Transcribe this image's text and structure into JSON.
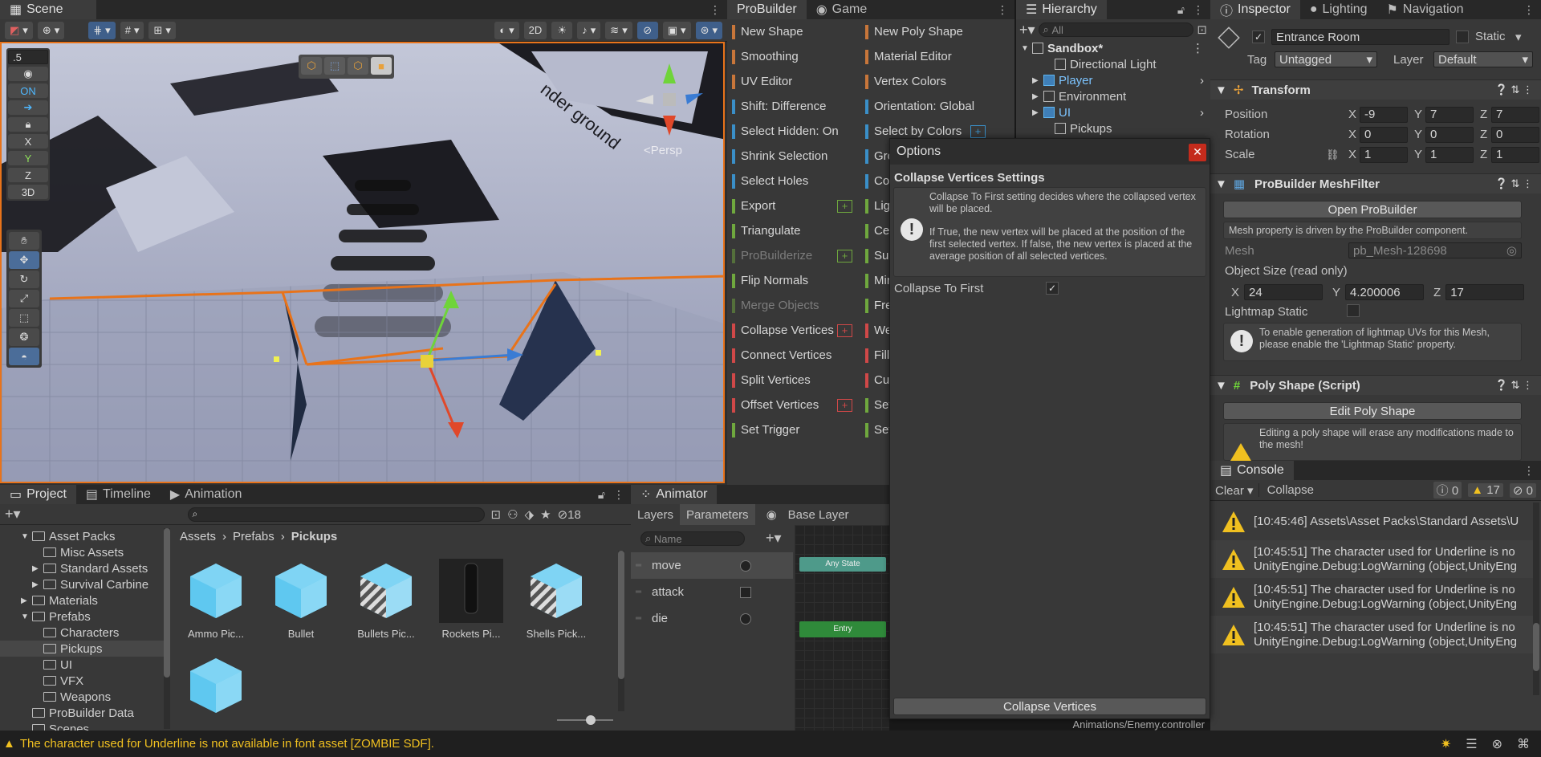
{
  "scene": {
    "tab": "Scene",
    "twod": "2D",
    "grid_snap": ".5",
    "on_label": "ON",
    "axes": [
      "X",
      "Y",
      "Z"
    ],
    "threed": "3D",
    "persp": "<Persp",
    "ground_text": "nder ground"
  },
  "probuilder": {
    "tab": "ProBuilder",
    "game_tab": "Game",
    "left": [
      {
        "label": "New Shape",
        "color": "#c8763a",
        "plus": false,
        "disabled": false
      },
      {
        "label": "Smoothing",
        "color": "#c8763a",
        "plus": false,
        "disabled": false
      },
      {
        "label": "UV Editor",
        "color": "#c8763a",
        "plus": false,
        "disabled": false
      },
      {
        "label": "Shift: Difference",
        "color": "#3a8fc8",
        "plus": false,
        "disabled": false
      },
      {
        "label": "Select Hidden: On",
        "color": "#3a8fc8",
        "plus": false,
        "disabled": false
      },
      {
        "label": "Shrink Selection",
        "color": "#3a8fc8",
        "plus": false,
        "disabled": false
      },
      {
        "label": "Select Holes",
        "color": "#3a8fc8",
        "plus": false,
        "disabled": false
      },
      {
        "label": "Export",
        "color": "#6fa83e",
        "plus": true,
        "disabled": false
      },
      {
        "label": "Triangulate",
        "color": "#6fa83e",
        "plus": false,
        "disabled": false
      },
      {
        "label": "ProBuilderize",
        "color": "#6fa83e",
        "plus": true,
        "disabled": true
      },
      {
        "label": "Flip Normals",
        "color": "#6fa83e",
        "plus": false,
        "disabled": false
      },
      {
        "label": "Merge Objects",
        "color": "#6fa83e",
        "plus": false,
        "disabled": true
      },
      {
        "label": "Collapse Vertices",
        "color": "#d04848",
        "plus": true,
        "disabled": false
      },
      {
        "label": "Connect Vertices",
        "color": "#d04848",
        "plus": false,
        "disabled": false
      },
      {
        "label": "Split Vertices",
        "color": "#d04848",
        "plus": false,
        "disabled": false
      },
      {
        "label": "Offset Vertices",
        "color": "#d04848",
        "plus": true,
        "disabled": false
      },
      {
        "label": "Set Trigger",
        "color": "#6fa83e",
        "plus": false,
        "disabled": false
      }
    ],
    "right": [
      {
        "label": "New Poly Shape",
        "color": "#c8763a",
        "plus": false
      },
      {
        "label": "Material Editor",
        "color": "#c8763a",
        "plus": false
      },
      {
        "label": "Vertex Colors",
        "color": "#c8763a",
        "plus": false
      },
      {
        "label": "Orientation: Global",
        "color": "#3a8fc8",
        "plus": false
      },
      {
        "label": "Select by Colors",
        "color": "#3a8fc8",
        "plus": true
      },
      {
        "label": "Gro",
        "color": "#3a8fc8",
        "plus": false
      },
      {
        "label": "Cor",
        "color": "#3a8fc8",
        "plus": false
      },
      {
        "label": "Ligh",
        "color": "#6fa83e",
        "plus": false
      },
      {
        "label": "Cen",
        "color": "#6fa83e",
        "plus": false
      },
      {
        "label": "Sub",
        "color": "#6fa83e",
        "plus": false
      },
      {
        "label": "Mir",
        "color": "#6fa83e",
        "plus": false
      },
      {
        "label": "Free",
        "color": "#6fa83e",
        "plus": false
      },
      {
        "label": "Wel",
        "color": "#d04848",
        "plus": false
      },
      {
        "label": "Fill",
        "color": "#d04848",
        "plus": false
      },
      {
        "label": "Cut",
        "color": "#d04848",
        "plus": false
      },
      {
        "label": "Set",
        "color": "#6fa83e",
        "plus": false
      },
      {
        "label": "Set",
        "color": "#6fa83e",
        "plus": false
      }
    ]
  },
  "hierarchy": {
    "tab": "Hierarchy",
    "search_placeholder": "All",
    "items": [
      {
        "label": "Sandbox*",
        "indent": 0,
        "bold": true,
        "arrow": "▼"
      },
      {
        "label": "Directional Light",
        "indent": 2,
        "bold": false,
        "arrow": ""
      },
      {
        "label": "Player",
        "indent": 1,
        "bold": false,
        "arrow": "▶",
        "blue": true
      },
      {
        "label": "Environment",
        "indent": 1,
        "bold": false,
        "arrow": "▶"
      },
      {
        "label": "UI",
        "indent": 1,
        "bold": false,
        "arrow": "▶",
        "blue": true
      },
      {
        "label": "Pickups",
        "indent": 2,
        "bold": false,
        "arrow": ""
      }
    ]
  },
  "options": {
    "title": "Options",
    "section": "Collapse Vertices Settings",
    "help": "Collapse To First setting decides where the collapsed vertex will be placed.",
    "help2": "If True, the new vertex will be placed at the position of the first selected vertex.  If false, the new vertex is placed at the average position of all selected vertices.",
    "toggle_label": "Collapse To First",
    "button": "Collapse Vertices",
    "footer": "Animations/Enemy.controller"
  },
  "inspector": {
    "tabs": [
      "Inspector",
      "Lighting",
      "Navigation"
    ],
    "object_name": "Entrance Room",
    "static_label": "Static",
    "tag_label": "Tag",
    "tag_value": "Untagged",
    "layer_label": "Layer",
    "layer_value": "Default",
    "transform": {
      "title": "Transform",
      "rows": [
        {
          "label": "Position",
          "x": "-9",
          "y": "7",
          "z": "7"
        },
        {
          "label": "Rotation",
          "x": "0",
          "y": "0",
          "z": "0"
        },
        {
          "label": "Scale",
          "x": "1",
          "y": "1",
          "z": "1"
        }
      ]
    },
    "meshfilter": {
      "title": "ProBuilder MeshFilter",
      "open_button": "Open ProBuilder",
      "driven_note": "Mesh property is driven by the ProBuilder component.",
      "mesh_label": "Mesh",
      "mesh_value": "pb_Mesh-128698",
      "size_label": "Object Size (read only)",
      "size_x": "24",
      "size_y": "4.200006",
      "size_z": "17",
      "lightmap_label": "Lightmap Static",
      "lightmap_help": "To enable generation of lightmap UVs for this Mesh, please enable the 'Lightmap Static' property."
    },
    "polyshape": {
      "title": "Poly Shape (Script)",
      "edit_button": "Edit Poly Shape",
      "warn": "Editing a poly shape will erase any modifications made to the mesh!"
    }
  },
  "console": {
    "tab": "Console",
    "clear": "Clear",
    "collapse": "Collapse",
    "count_info": "0",
    "count_warn": "17",
    "count_err": "0",
    "rows": [
      {
        "line1": "[10:45:46] Assets\\Asset Packs\\Standard Assets\\U",
        "line2": ""
      },
      {
        "line1": "[10:45:51] The character used for Underline is no",
        "line2": "UnityEngine.Debug:LogWarning (object,UnityEng"
      },
      {
        "line1": "[10:45:51] The character used for Underline is no",
        "line2": "UnityEngine.Debug:LogWarning (object,UnityEng"
      },
      {
        "line1": "[10:45:51] The character used for Underline is no",
        "line2": "UnityEngine.Debug:LogWarning (object,UnityEng"
      }
    ]
  },
  "project": {
    "tabs": [
      "Project",
      "Timeline",
      "Animation"
    ],
    "count": "18",
    "breadcrumb": [
      "Assets",
      "Prefabs",
      "Pickups"
    ],
    "tree": [
      {
        "label": "Asset Packs",
        "indent": 1,
        "arrow": "▼"
      },
      {
        "label": "Misc Assets",
        "indent": 2,
        "arrow": ""
      },
      {
        "label": "Standard Assets",
        "indent": 2,
        "arrow": "▶"
      },
      {
        "label": "Survival Carbine",
        "indent": 2,
        "arrow": "▶"
      },
      {
        "label": "Materials",
        "indent": 1,
        "arrow": "▶"
      },
      {
        "label": "Prefabs",
        "indent": 1,
        "arrow": "▼"
      },
      {
        "label": "Characters",
        "indent": 2,
        "arrow": ""
      },
      {
        "label": "Pickups",
        "indent": 2,
        "arrow": "",
        "sel": true
      },
      {
        "label": "UI",
        "indent": 2,
        "arrow": ""
      },
      {
        "label": "VFX",
        "indent": 2,
        "arrow": ""
      },
      {
        "label": "Weapons",
        "indent": 2,
        "arrow": ""
      },
      {
        "label": "ProBuilder Data",
        "indent": 1,
        "arrow": ""
      },
      {
        "label": "Scenes",
        "indent": 1,
        "arrow": ""
      }
    ],
    "assets": [
      {
        "label": "Ammo Pic...",
        "kind": "cube"
      },
      {
        "label": "Bullet",
        "kind": "cube"
      },
      {
        "label": "Bullets Pic...",
        "kind": "striped"
      },
      {
        "label": "Rockets Pi...",
        "kind": "rocket"
      },
      {
        "label": "Shells Pick...",
        "kind": "striped"
      },
      {
        "label": "",
        "kind": "cube"
      }
    ]
  },
  "animator": {
    "tab": "Animator",
    "layers": "Layers",
    "parameters": "Parameters",
    "base_layer": "Base Layer",
    "name_placeholder": "Name",
    "params": [
      {
        "label": "move",
        "kind": "float"
      },
      {
        "label": "attack",
        "kind": "bool"
      },
      {
        "label": "die",
        "kind": "float"
      }
    ],
    "any_state": "Any State",
    "entry": "Entry"
  },
  "status": {
    "message": "The character used for Underline is not available in font asset [ZOMBIE SDF]."
  }
}
